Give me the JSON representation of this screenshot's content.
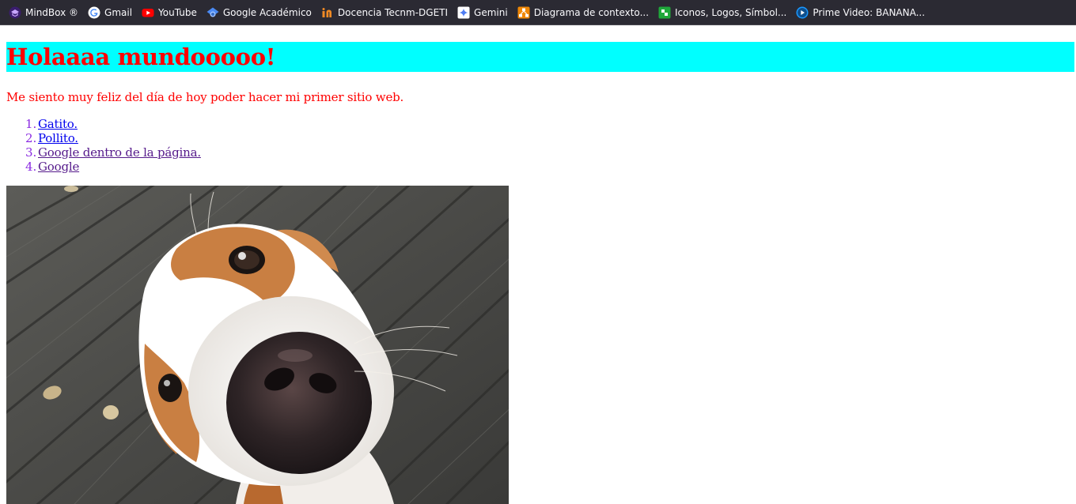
{
  "bookmarks": [
    {
      "label": "MindBox ®",
      "icon": "mindbox-icon"
    },
    {
      "label": "Gmail",
      "icon": "google-icon"
    },
    {
      "label": "YouTube",
      "icon": "youtube-icon"
    },
    {
      "label": "Google Académico",
      "icon": "google-scholar-icon"
    },
    {
      "label": "Docencia Tecnm-DGETI",
      "icon": "docencia-icon"
    },
    {
      "label": "Gemini",
      "icon": "gemini-icon"
    },
    {
      "label": "Diagrama de contexto...",
      "icon": "diagram-icon"
    },
    {
      "label": "Iconos, Logos, Símbol...",
      "icon": "icons-site-icon"
    },
    {
      "label": "Prime Video: BANANA...",
      "icon": "prime-video-icon"
    }
  ],
  "page": {
    "heading": "Holaaaa mundooooo!",
    "intro": "Me siento muy feliz del día de hoy poder hacer mi primer sitio web.",
    "links": [
      {
        "number": "1.",
        "label": "Gatito.",
        "state": "unvisited"
      },
      {
        "number": "2.",
        "label": "Pollito.",
        "state": "unvisited"
      },
      {
        "number": "3.",
        "label": "Google dentro de la página.",
        "state": "visited"
      },
      {
        "number": "4.",
        "label": "Google",
        "state": "visited"
      }
    ],
    "image_subject": "dog-closeup-photo"
  },
  "colors": {
    "toolbar_bg": "#2b2a33",
    "heading_bg": "#00ffff",
    "heading_text": "#ff0000",
    "intro_text": "#ff0000",
    "list_marker": "#8a2be2",
    "link_unvisited": "#0000ee",
    "link_visited": "#551a8b"
  }
}
